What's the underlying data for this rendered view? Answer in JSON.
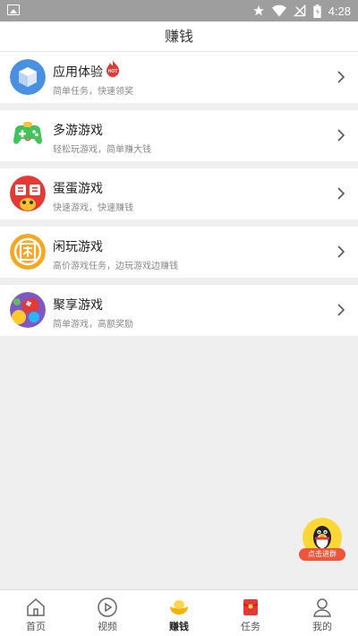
{
  "status_bar": {
    "time": "4:28"
  },
  "header": {
    "title": "赚钱"
  },
  "items": [
    {
      "title": "应用体验",
      "subtitle": "简单任务，快速领奖",
      "badge": "HOT",
      "icon": "app-cube-icon"
    },
    {
      "title": "多游游戏",
      "subtitle": "轻松玩游戏，简单赚大钱",
      "icon": "gamepad-icon"
    },
    {
      "title": "蛋蛋游戏",
      "subtitle": "快速游戏，快速赚钱",
      "icon": "dandan-logo-icon"
    },
    {
      "title": "闲玩游戏",
      "subtitle": "高价游戏任务，边玩游戏边赚钱",
      "icon": "xianwan-logo-icon"
    },
    {
      "title": "聚享游戏",
      "subtitle": "简单游戏，高额奖励",
      "icon": "juxiang-logo-icon"
    }
  ],
  "float_button": {
    "label": "点击进群",
    "icon": "qq-penguin-icon"
  },
  "tabs": [
    {
      "label": "首页",
      "icon": "home-icon"
    },
    {
      "label": "视频",
      "icon": "play-icon"
    },
    {
      "label": "赚钱",
      "icon": "gold-ingot-icon",
      "active": true
    },
    {
      "label": "任务",
      "icon": "red-envelope-icon"
    },
    {
      "label": "我的",
      "icon": "user-icon"
    }
  ]
}
